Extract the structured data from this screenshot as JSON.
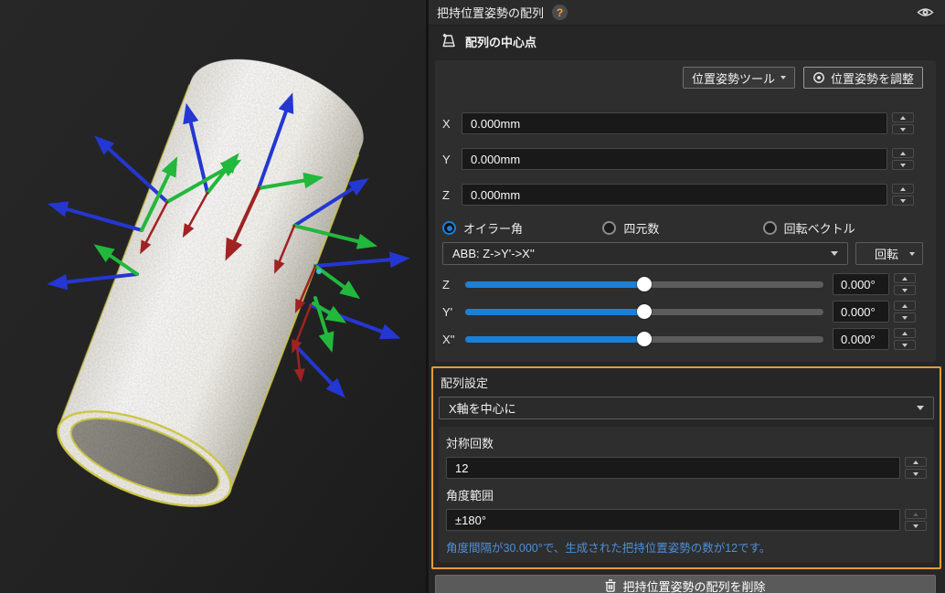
{
  "panel": {
    "title": "把持位置姿勢の配列",
    "help_label": "?",
    "section_title": "配列の中心点",
    "toolbar": {
      "pose_tools_label": "位置姿勢ツール",
      "adjust_pose_label": "位置姿勢を調整"
    },
    "position_fields": [
      {
        "axis": "X",
        "value": "0.000mm"
      },
      {
        "axis": "Y",
        "value": "0.000mm"
      },
      {
        "axis": "Z",
        "value": "0.000mm"
      }
    ],
    "rotation_modes": [
      {
        "label": "オイラー角",
        "selected": true
      },
      {
        "label": "四元数",
        "selected": false
      },
      {
        "label": "回転ベクトル",
        "selected": false
      }
    ],
    "euler_convention": "ABB: Z->Y'->X''",
    "rotate_button_label": "回転",
    "sliders": [
      {
        "axis": "Z",
        "value": "0.000°"
      },
      {
        "axis": "Y'",
        "value": "0.000°"
      },
      {
        "axis": "X''",
        "value": "0.000°"
      }
    ],
    "array_settings": {
      "title": "配列設定",
      "axis_mode": "X軸を中心に",
      "symmetry_label": "対称回数",
      "symmetry_value": "12",
      "angle_range_label": "角度範囲",
      "angle_range_value": "±180°",
      "info_text": "角度間隔が30.000°で、生成された把持位置姿勢の数が12です。"
    },
    "delete_button_label": "把持位置姿勢の配列を削除"
  },
  "icons": {
    "help": "question-mark",
    "visibility": "eye",
    "section": "array-center-pose",
    "adjust": "target-circle",
    "delete": "trash-can"
  },
  "colors": {
    "accent_blue": "#1a80d8",
    "highlight_orange": "#ef9a38",
    "info_text_blue": "#4d90d8",
    "axis_x_red": "#a02222",
    "axis_y_green": "#21b83c",
    "axis_z_blue": "#2437d2",
    "cloud_outline_yellow": "#dcd54a",
    "panel_bg": "#262626",
    "groupbox_bg": "#2e2e2e"
  }
}
